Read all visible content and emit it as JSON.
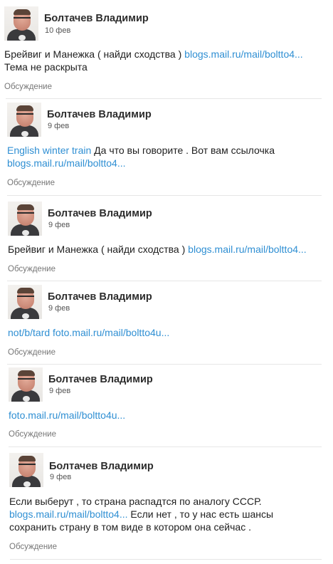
{
  "author": "Болтачев Владимир",
  "discussion_label": "Обсуждение",
  "posts": [
    {
      "date": "10 фев",
      "parts": [
        {
          "text": "Брейвиг и Манежка ( найди сходства ) ",
          "link": false
        },
        {
          "text": "blogs.mail.ru/mail/boltto4...",
          "link": true
        },
        {
          "text": "Тема не раскрыта",
          "link": false
        }
      ]
    },
    {
      "date": "9 фев",
      "parts": [
        {
          "text": "English winter train",
          "link": true
        },
        {
          "text": " Да что вы говорите . Вот вам ссылочка ",
          "link": false
        },
        {
          "text": "blogs.mail.ru/mail/boltto4...",
          "link": true
        }
      ]
    },
    {
      "date": "9 фев",
      "parts": [
        {
          "text": "Брейвиг и Манежка ( найди сходства ) ",
          "link": false
        },
        {
          "text": "blogs.mail.ru/mail/boltto4...",
          "link": true
        }
      ]
    },
    {
      "date": "9 фев",
      "parts": [
        {
          "text": "not/b/tard",
          "link": true
        },
        {
          "text": " ",
          "link": false
        },
        {
          "text": "foto.mail.ru/mail/boltto4u...",
          "link": true
        }
      ]
    },
    {
      "date": "9 фев",
      "parts": [
        {
          "text": "foto.mail.ru/mail/boltto4u...",
          "link": true
        }
      ]
    },
    {
      "date": "9 фев",
      "parts": [
        {
          "text": "Если выберут , то страна распадтся по аналогу СССР. ",
          "link": false
        },
        {
          "text": "blogs.mail.ru/mail/boltto4...",
          "link": true
        },
        {
          "text": " Если нет , то у нас есть шансы сохранить страну в том виде в котором она сейчас .",
          "link": false
        }
      ]
    }
  ]
}
